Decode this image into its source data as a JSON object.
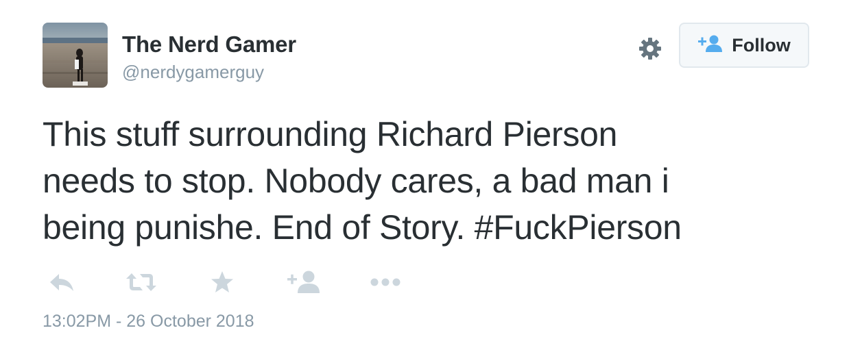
{
  "user": {
    "display_name": "The Nerd Gamer",
    "screen_name": "@nerdygamerguy",
    "avatar_icon": "profile-photo"
  },
  "header": {
    "settings_icon": "gear-icon",
    "follow_label": "Follow",
    "follow_icon": "add-user-icon"
  },
  "tweet": {
    "lines": [
      "This stuff surrounding Richard Pierson",
      "needs to stop. Nobody cares, a bad man i",
      "being punishe. End of Story. #FuckPierson"
    ],
    "timestamp": "13:02PM - 26 October 2018"
  },
  "actions": [
    {
      "icon": "reply-icon"
    },
    {
      "icon": "retweet-icon"
    },
    {
      "icon": "favorite-star-icon"
    },
    {
      "icon": "follow-user-icon"
    },
    {
      "icon": "more-dots-icon"
    }
  ],
  "colors": {
    "text": "#292f33",
    "muted": "#8899a6",
    "icon_grey": "#ccd6dd",
    "follow_icon_blue": "#55acee",
    "button_bg": "#f5f8fa",
    "button_border": "#e1e8ed"
  }
}
